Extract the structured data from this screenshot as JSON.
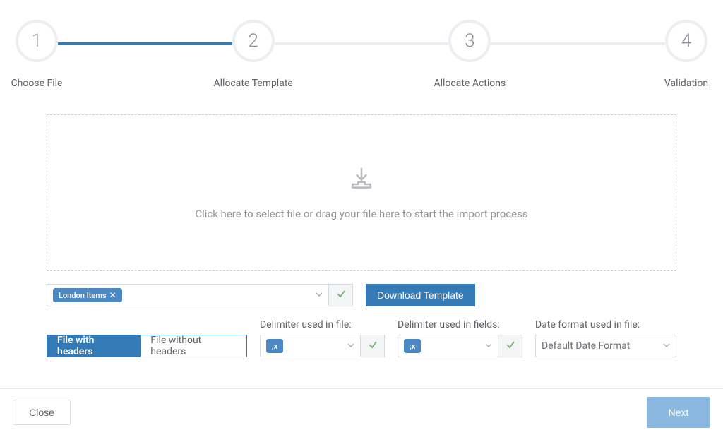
{
  "stepper": {
    "steps": [
      {
        "num": "1",
        "label": "Choose File"
      },
      {
        "num": "2",
        "label": "Allocate Template"
      },
      {
        "num": "3",
        "label": "Allocate Actions"
      },
      {
        "num": "4",
        "label": "Validation"
      }
    ],
    "active_index": 0
  },
  "dropzone": {
    "text": "Click here to select file or drag your file here to start the import process"
  },
  "template_select": {
    "selected_chip": "London Items"
  },
  "download_button": "Download Template",
  "headers_toggle": {
    "with": "File with headers",
    "without": "File without headers",
    "active": "with"
  },
  "file_delimiter": {
    "label": "Delimiter used in file:",
    "selected_chip": ",x"
  },
  "field_delimiter": {
    "label": "Delimiter used in fields:",
    "selected_chip": ";x"
  },
  "date_format": {
    "label": "Date format used in file:",
    "selected": "Default Date Format"
  },
  "footer": {
    "close": "Close",
    "next": "Next"
  }
}
